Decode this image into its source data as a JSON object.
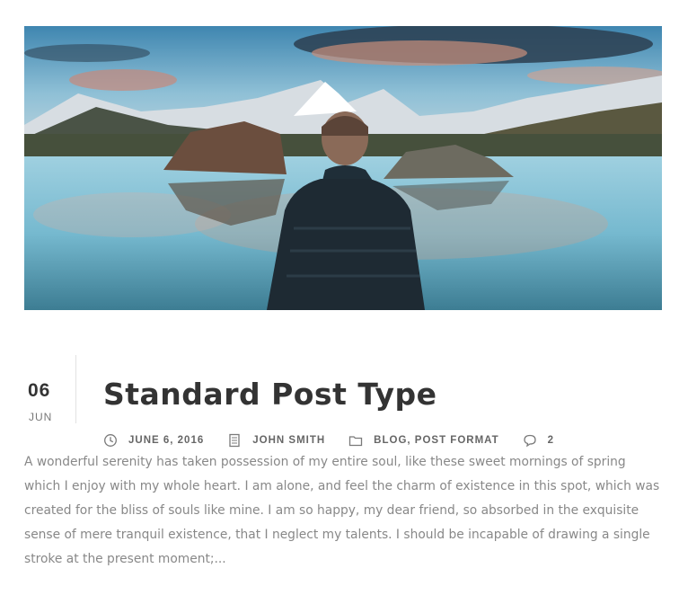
{
  "post": {
    "image_alt": "Man in a dark puffer jacket looking at a mountain lake",
    "date": {
      "day": "06",
      "month": "JUN"
    },
    "title": "Standard Post Type",
    "meta": {
      "date": "JUNE 6, 2016",
      "author": "JOHN SMITH",
      "categories": [
        "BLOG",
        "POST FORMAT"
      ],
      "category_separator": ", ",
      "comments": "2"
    },
    "excerpt": "A wonderful serenity has taken possession of my entire soul, like these sweet mornings of spring which I enjoy with my whole heart. I am alone, and feel the charm of existence in this spot, which was created for the bliss of souls like mine. I am so happy, my dear friend, so absorbed in the exquisite sense of mere tranquil existence, that I neglect my talents. I should be incapable of drawing a single stroke at the present moment;..."
  },
  "icons": {
    "date": "clock-icon",
    "author": "document-icon",
    "category": "folder-icon",
    "comments": "comment-icon"
  },
  "colors": {
    "text_dark": "#333333",
    "text_meta": "#666666",
    "text_body": "#888888",
    "divider": "#e2e2e2"
  }
}
